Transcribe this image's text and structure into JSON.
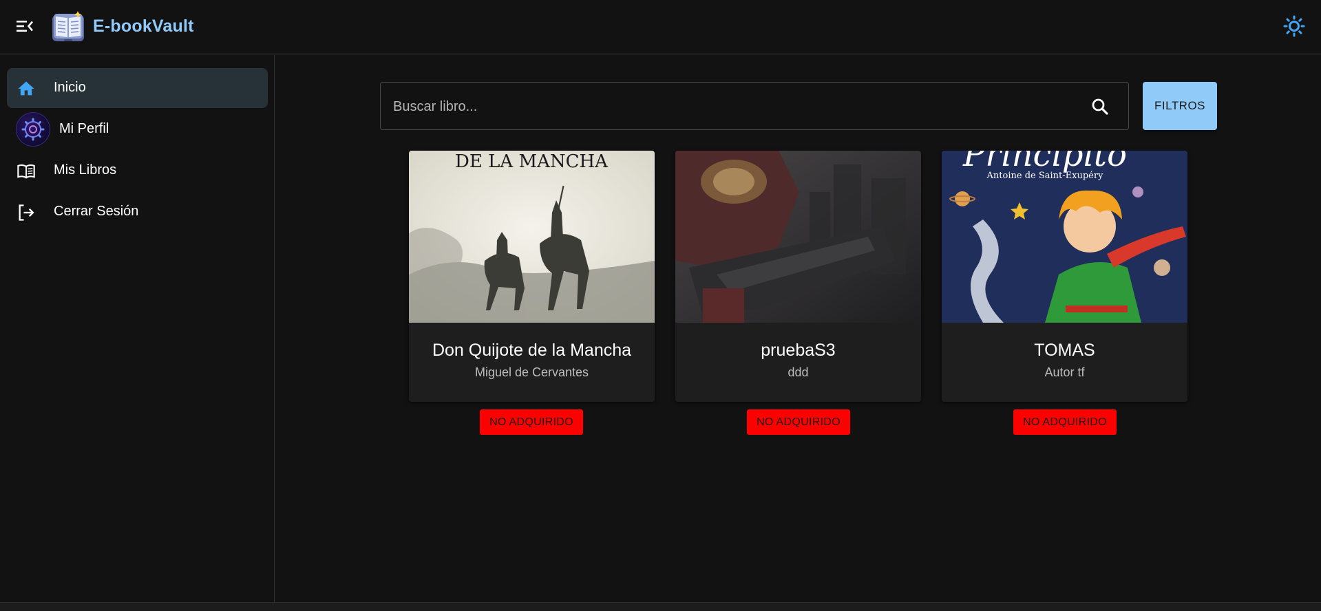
{
  "app": {
    "brand": "E-bookVault"
  },
  "icons": {
    "menu": "menu-collapse-icon",
    "logo": "open-book-logo",
    "theme": "sun-icon",
    "search": "search-icon"
  },
  "colors": {
    "accent": "#90caf9",
    "active_nav": "#263238",
    "badge": "#ff0000",
    "home_icon": "#42a5f5"
  },
  "sidebar": {
    "items": [
      {
        "label": "Inicio",
        "icon": "home-icon",
        "active": true
      },
      {
        "label": "Mi Perfil",
        "icon": "avatar",
        "active": false
      },
      {
        "label": "Mis Libros",
        "icon": "book-icon",
        "active": false
      },
      {
        "label": "Cerrar Sesión",
        "icon": "logout-icon",
        "active": false
      }
    ]
  },
  "search": {
    "placeholder": "Buscar libro...",
    "value": "",
    "filters_label": "FILTROS"
  },
  "books": [
    {
      "title": "Don Quijote de la Mancha",
      "author": "Miguel de Cervantes",
      "cover_text": "DE LA MANCHA",
      "status": "NO ADQUIRIDO"
    },
    {
      "title": "pruebaS3",
      "author": "ddd",
      "status": "NO ADQUIRIDO"
    },
    {
      "title": "TOMAS",
      "author": "Autor tf",
      "cover_text": "Principito",
      "cover_subtext": "Antoine de Saint-Exupéry",
      "status": "NO ADQUIRIDO"
    }
  ]
}
